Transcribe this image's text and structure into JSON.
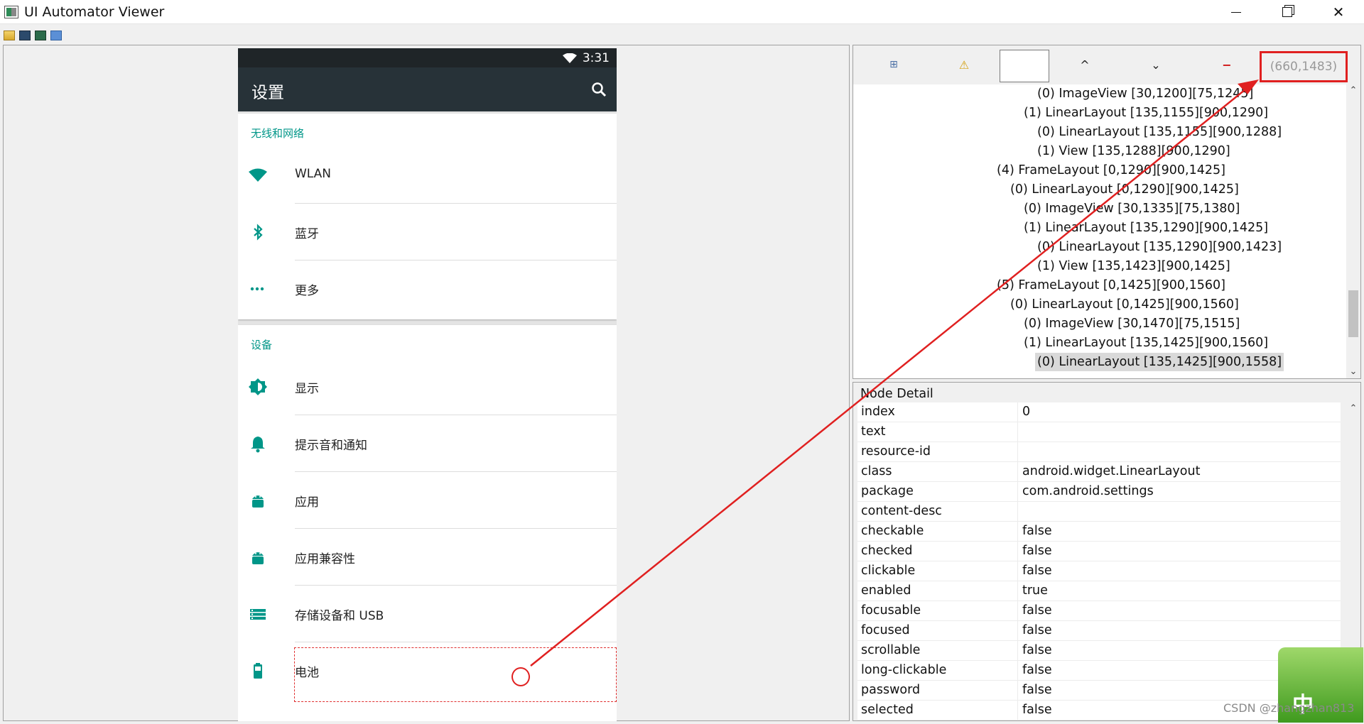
{
  "window": {
    "title": "UI Automator Viewer",
    "controls": {
      "minimize": "—",
      "close": "✕"
    }
  },
  "phone": {
    "status_time": "3:31",
    "appbar_title": "设置",
    "sections": [
      {
        "title": "无线和网络",
        "items": [
          {
            "label": "WLAN",
            "icon": "wifi-icon"
          },
          {
            "label": "蓝牙",
            "icon": "bluetooth-icon"
          },
          {
            "label": "更多",
            "icon": "more-icon"
          }
        ]
      },
      {
        "title": "设备",
        "items": [
          {
            "label": "显示",
            "icon": "brightness-icon"
          },
          {
            "label": "提示音和通知",
            "icon": "bell-icon"
          },
          {
            "label": "应用",
            "icon": "android-icon"
          },
          {
            "label": "应用兼容性",
            "icon": "android-icon"
          },
          {
            "label": "存储设备和 USB",
            "icon": "storage-icon"
          },
          {
            "label": "电池",
            "icon": "battery-icon"
          }
        ]
      }
    ]
  },
  "hierarchy": {
    "toolbar": {
      "expand": "⊞",
      "warn": "⚠",
      "prev": "^",
      "next": "⌄",
      "minus": "−"
    },
    "coordinates": "(660,1483)",
    "tree": [
      {
        "text": "(0) ImageView [30,1200][75,1245]",
        "depth": 3
      },
      {
        "text": "(1) LinearLayout [135,1155][900,1290]",
        "depth": 2
      },
      {
        "text": "(0) LinearLayout [135,1155][900,1288]",
        "depth": 3
      },
      {
        "text": "(1) View [135,1288][900,1290]",
        "depth": 3
      },
      {
        "text": "(4) FrameLayout [0,1290][900,1425]",
        "depth": 0
      },
      {
        "text": "(0) LinearLayout [0,1290][900,1425]",
        "depth": 1
      },
      {
        "text": "(0) ImageView [30,1335][75,1380]",
        "depth": 2
      },
      {
        "text": "(1) LinearLayout [135,1290][900,1425]",
        "depth": 2
      },
      {
        "text": "(0) LinearLayout [135,1290][900,1423]",
        "depth": 3
      },
      {
        "text": "(1) View [135,1423][900,1425]",
        "depth": 3
      },
      {
        "text": "(5) FrameLayout [0,1425][900,1560]",
        "depth": 0
      },
      {
        "text": "(0) LinearLayout [0,1425][900,1560]",
        "depth": 1
      },
      {
        "text": "(0) ImageView [30,1470][75,1515]",
        "depth": 2
      },
      {
        "text": "(1) LinearLayout [135,1425][900,1560]",
        "depth": 2
      },
      {
        "text": "(0) LinearLayout [135,1425][900,1558]",
        "depth": 3,
        "selected": true
      }
    ]
  },
  "node_detail": {
    "title": "Node Detail",
    "rows": [
      {
        "key": "index",
        "value": "0"
      },
      {
        "key": "text",
        "value": ""
      },
      {
        "key": "resource-id",
        "value": ""
      },
      {
        "key": "class",
        "value": "android.widget.LinearLayout"
      },
      {
        "key": "package",
        "value": "com.android.settings"
      },
      {
        "key": "content-desc",
        "value": ""
      },
      {
        "key": "checkable",
        "value": "false"
      },
      {
        "key": "checked",
        "value": "false"
      },
      {
        "key": "clickable",
        "value": "false"
      },
      {
        "key": "enabled",
        "value": "true"
      },
      {
        "key": "focusable",
        "value": "false"
      },
      {
        "key": "focused",
        "value": "false"
      },
      {
        "key": "scrollable",
        "value": "false"
      },
      {
        "key": "long-clickable",
        "value": "false"
      },
      {
        "key": "password",
        "value": "false"
      },
      {
        "key": "selected",
        "value": "false"
      }
    ]
  },
  "ime": {
    "label": "中"
  },
  "watermark": "CSDN @zhangzhan813",
  "colors": {
    "accent": "#009688",
    "appbar": "#273238",
    "annotation": "#e02020"
  }
}
